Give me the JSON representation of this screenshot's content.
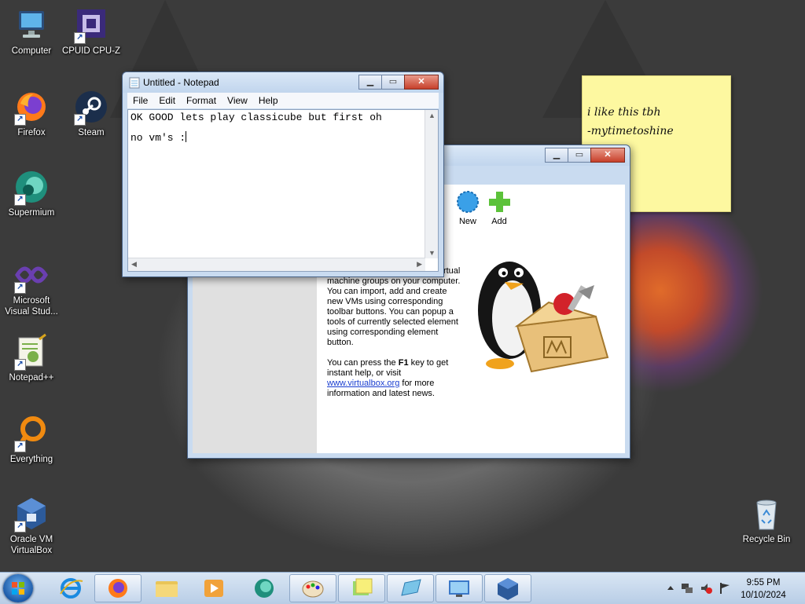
{
  "desktop": {
    "icons": [
      {
        "label": "Computer",
        "icon": "computer-icon"
      },
      {
        "label": "CPUID CPU-Z",
        "icon": "cpuz-icon"
      },
      {
        "label": "Firefox",
        "icon": "firefox-icon"
      },
      {
        "label": "Steam",
        "icon": "steam-icon"
      },
      {
        "label": "Supermium",
        "icon": "supermium-icon"
      },
      {
        "label": "Microsoft Visual Stud...",
        "icon": "visual-studio-icon"
      },
      {
        "label": "Notepad++",
        "icon": "notepadpp-icon"
      },
      {
        "label": "Everything",
        "icon": "everything-icon"
      },
      {
        "label": "Oracle VM VirtualBox",
        "icon": "virtualbox-icon"
      },
      {
        "label": "Recycle Bin",
        "icon": "recycle-bin-icon"
      }
    ]
  },
  "notepad": {
    "title": "Untitled - Notepad",
    "menu": [
      "File",
      "Edit",
      "Format",
      "View",
      "Help"
    ],
    "lines": [
      "OK GOOD lets play classicube but first oh",
      "no vm's :"
    ]
  },
  "virtualbox": {
    "tools": [
      {
        "label": "New"
      },
      {
        "label": "Add"
      }
    ],
    "welcome_partial": "lists all virtual machines and virtual machine groups on your computer. You can import, add and create new VMs using corresponding toolbar buttons. You can popup a tools of currently selected element using corresponding element button.",
    "f1_prefix": "You can press the ",
    "f1_key": "F1",
    "f1_suffix": " key to get instant help, or visit ",
    "link": "www.virtualbox.org",
    "link_suffix": " for more information and latest news."
  },
  "sticky_note": {
    "line1": "i like this tbh",
    "line2": "-mytimetoshine",
    "color": "#fdf8a0"
  },
  "taskbar": {
    "time": "9:55 PM",
    "date": "10/10/2024",
    "pinned": [
      "internet-explorer-icon",
      "firefox-icon",
      "file-explorer-icon",
      "media-player-icon",
      "supermium-icon",
      "paint-icon",
      "sticky-notes-icon",
      "notepad-icon",
      "remote-desktop-icon",
      "virtualbox-icon"
    ]
  }
}
